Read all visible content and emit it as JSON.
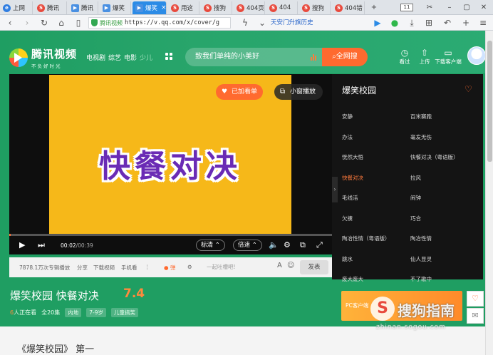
{
  "browser": {
    "tabs": [
      {
        "label": "上网",
        "icon": "blue-globe-icon",
        "active": false
      },
      {
        "label": "腾讯",
        "icon": "sogou-icon",
        "active": false
      },
      {
        "label": "腾讯",
        "icon": "tencent-video-icon",
        "active": false
      },
      {
        "label": "爆笑",
        "icon": "tencent-video-icon",
        "active": false
      },
      {
        "label": "爆笑",
        "icon": "tencent-video-icon",
        "active": true
      },
      {
        "label": "用这",
        "icon": "sogou-icon",
        "active": false
      },
      {
        "label": "搜狗",
        "icon": "sogou-icon",
        "active": false
      },
      {
        "label": "404页",
        "icon": "sogou-icon",
        "active": false
      },
      {
        "label": "404",
        "icon": "sogou-icon",
        "active": false
      },
      {
        "label": "搜狗",
        "icon": "sogou-icon",
        "active": false
      },
      {
        "label": "404错",
        "icon": "sogou-icon",
        "active": false
      }
    ],
    "tab_count": "11",
    "address": {
      "site_name": "腾讯视频",
      "url": "https://v.qq.com/x/cover/g"
    },
    "hot_search": "天安门升旗历史"
  },
  "header": {
    "logo_text": "腾讯视频",
    "logo_slogan": "不负好时光",
    "nav": [
      "电视剧",
      "综艺",
      "电影",
      "少儿"
    ],
    "search_placeholder": "致我们单纯的小美好",
    "search_button": "全网搜",
    "actions": [
      {
        "label": "看过",
        "icon": "clock-icon"
      },
      {
        "label": "上传",
        "icon": "upload-icon"
      },
      {
        "label": "下载客户端",
        "icon": "monitor-icon"
      }
    ]
  },
  "player": {
    "frame_title": "快餐对决",
    "add_list": "已加看单",
    "mini_play": "小窗播放",
    "time_current": "00:02",
    "time_total": "/00:39",
    "quality": "标清",
    "speed": "倍速",
    "progress": 0.005
  },
  "playlist": {
    "title": "爆笑校园",
    "episodes": [
      "安静",
      "百米赛跑",
      "办法",
      "毫发无伤",
      "恍然大悟",
      "快餐对决（粤语版）",
      "快餐对决",
      "拉风",
      "毛线活",
      "闹钟",
      "欠揍",
      "巧合",
      "陶冶性情（粤语版）",
      "陶冶性情",
      "跳水",
      "仙人显灵",
      "废大废大",
      "不了歌中"
    ],
    "current_index": 6
  },
  "infobar": {
    "plays": "7878.1万次专辑播放",
    "share": "分享",
    "download": "下载视频",
    "mobile": "手机看",
    "more": "⋮",
    "danmu_label": "弹",
    "danmu_placeholder": "一起吐槽吧!",
    "send": "发表"
  },
  "show": {
    "title": "爆笑校园 快餐对决",
    "score": "7.4",
    "watching_count": "6",
    "watching_label": "人正在看",
    "episodes_total": "全20集",
    "tags": [
      "内地",
      "7-9岁",
      "儿童搞笑"
    ],
    "bottom_heading": "《爆笑校园》 第一"
  },
  "ad": {
    "label": "PC客户端"
  },
  "watermark": {
    "mark": "S",
    "text": "搜狗指南",
    "url": "zhinan.sogou.com"
  }
}
